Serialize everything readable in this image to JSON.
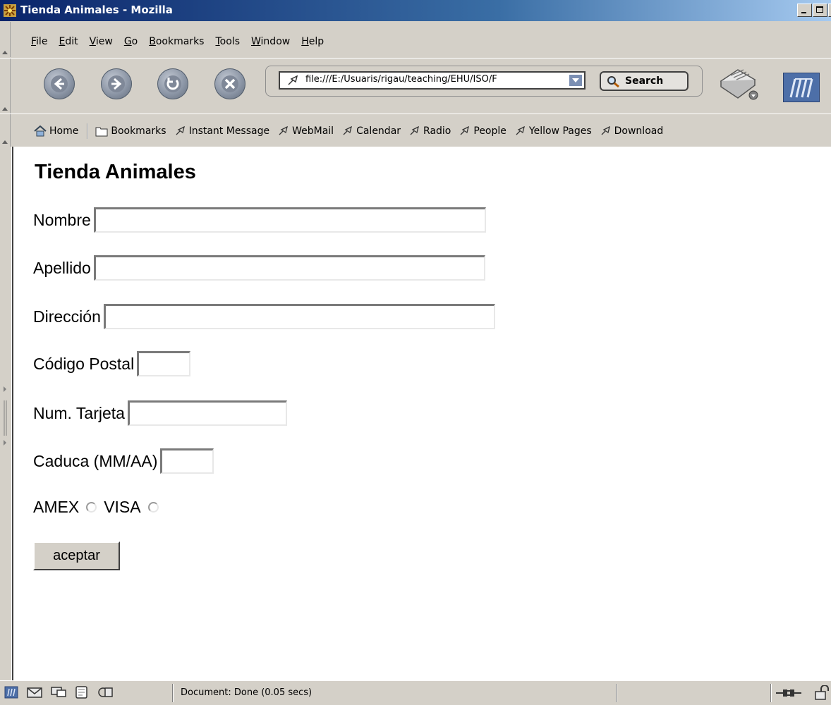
{
  "window": {
    "title": "Tienda Animales - Mozilla"
  },
  "menu": {
    "items": [
      {
        "label": "File",
        "mnemonic": "F",
        "rest": "ile"
      },
      {
        "label": "Edit",
        "mnemonic": "E",
        "rest": "dit"
      },
      {
        "label": "View",
        "mnemonic": "V",
        "rest": "iew"
      },
      {
        "label": "Go",
        "mnemonic": "G",
        "rest": "o"
      },
      {
        "label": "Bookmarks",
        "mnemonic": "B",
        "rest": "ookmarks"
      },
      {
        "label": "Tools",
        "mnemonic": "T",
        "rest": "ools"
      },
      {
        "label": "Window",
        "mnemonic": "W",
        "rest": "indow"
      },
      {
        "label": "Help",
        "mnemonic": "H",
        "rest": "elp"
      }
    ]
  },
  "navigation": {
    "url": "file:///E:/Usuaris/rigau/teaching/EHU/ISO/F",
    "search_label": "Search"
  },
  "personal_toolbar": {
    "home": "Home",
    "bookmarks": "Bookmarks",
    "links": [
      "Instant Message",
      "WebMail",
      "Calendar",
      "Radio",
      "People",
      "Yellow Pages",
      "Download"
    ]
  },
  "page": {
    "title": "Tienda Animales",
    "fields": {
      "nombre": {
        "label": "Nombre",
        "value": ""
      },
      "apellido": {
        "label": "Apellido",
        "value": ""
      },
      "direccion": {
        "label": "Dirección",
        "value": ""
      },
      "codigo_postal": {
        "label": "Código Postal",
        "value": ""
      },
      "num_tarjeta": {
        "label": "Num. Tarjeta",
        "value": ""
      },
      "caduca": {
        "label": "Caduca (MM/AA)",
        "value": ""
      }
    },
    "card_types": {
      "amex": "AMEX",
      "visa": "VISA"
    },
    "submit_label": "aceptar"
  },
  "status": {
    "text": "Document: Done (0.05 secs)"
  },
  "colors": {
    "titlebar_start": "#0a246a",
    "titlebar_end": "#a6caf0",
    "chrome": "#d4d0c8",
    "content_bg": "#ffffff"
  }
}
